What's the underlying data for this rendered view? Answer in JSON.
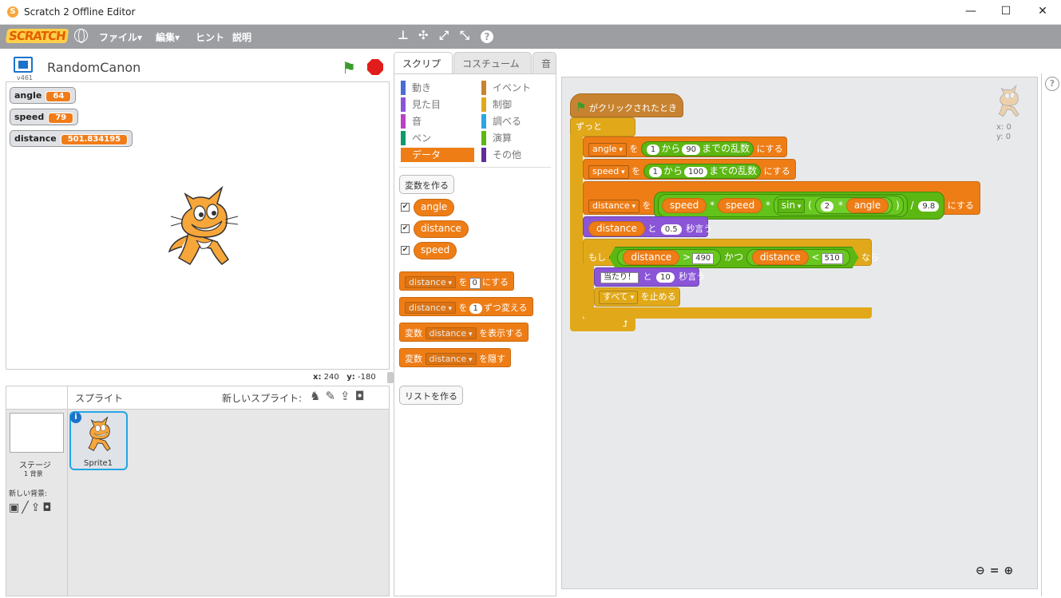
{
  "window": {
    "title": "Scratch 2 Offline Editor",
    "minimize": "—",
    "maximize": "☐",
    "close": "✕"
  },
  "menu": {
    "logo": "SCRATCH",
    "file": "ファイル▾",
    "edit": "編集▾",
    "tips": "ヒント",
    "about": "説明"
  },
  "toolbar": {
    "duplicate": "⊥",
    "delete": "✣",
    "grow": "⤢",
    "shrink": "⤡",
    "help": "?"
  },
  "stage": {
    "version": "v461",
    "project_name": "RandomCanon",
    "monitors": [
      {
        "name": "angle",
        "value": "64"
      },
      {
        "name": "speed",
        "value": "79"
      },
      {
        "name": "distance",
        "value": "501.834195"
      }
    ],
    "x_label": "x:",
    "x_value": "240",
    "y_label": "y:",
    "y_value": "-180"
  },
  "sprite_pane": {
    "sprites_label": "スプライト",
    "new_sprite_label": "新しいスプライト:",
    "stage_label": "ステージ",
    "stage_sub": "1 背景",
    "new_backdrop_label": "新しい背景:",
    "sprite_name": "Sprite1",
    "info": "i"
  },
  "tabs": [
    "スクリプト",
    "コスチューム",
    "音"
  ],
  "categories": [
    {
      "label": "動き",
      "color": "#4a6cd4"
    },
    {
      "label": "イベント",
      "color": "#c88330"
    },
    {
      "label": "見た目",
      "color": "#8a55d7"
    },
    {
      "label": "制御",
      "color": "#e1a91a"
    },
    {
      "label": "音",
      "color": "#bb42c3"
    },
    {
      "label": "調べる",
      "color": "#2ca5e2"
    },
    {
      "label": "ペン",
      "color": "#0e9a6c"
    },
    {
      "label": "演算",
      "color": "#5cb712"
    },
    {
      "label": "データ",
      "color": "#ee7d16"
    },
    {
      "label": "その他",
      "color": "#632d99"
    }
  ],
  "palette": {
    "make_var": "変数を作る",
    "vars": [
      "angle",
      "distance",
      "speed"
    ],
    "check": "✔",
    "set_block": {
      "var": "distance",
      "to": "を",
      "val": "0",
      "suffix": "にする"
    },
    "change_block": {
      "var": "distance",
      "to": "を",
      "val": "1",
      "suffix": "ずつ変える"
    },
    "show_block": {
      "prefix": "変数",
      "var": "distance",
      "suffix": "を表示する"
    },
    "hide_block": {
      "prefix": "変数",
      "var": "distance",
      "suffix": "を隠す"
    },
    "make_list": "リストを作る"
  },
  "script": {
    "hat": "がクリックされたとき",
    "forever": "ずっと",
    "set_angle": {
      "var": "angle",
      "wo": "を",
      "a": "1",
      "kara": "から",
      "b": "90",
      "rand": "までの乱数",
      "ni": "にする"
    },
    "set_speed": {
      "var": "speed",
      "wo": "を",
      "a": "1",
      "kara": "から",
      "b": "100",
      "rand": "までの乱数",
      "ni": "にする"
    },
    "set_distance": {
      "var": "distance",
      "wo": "を",
      "speed1": "speed",
      "mul1": "*",
      "speed2": "speed",
      "mul2": "*",
      "fn": "sin",
      "lp": "(",
      "two": "2",
      "mul3": "*",
      "angle": "angle",
      "rp": ")",
      "div": "/",
      "g": "9.8",
      "ni": "にする"
    },
    "say": {
      "var": "distance",
      "to": "と",
      "secs": "0.5",
      "suffix": "秒言う"
    },
    "if": {
      "moshi": "もし",
      "v1": "distance",
      "gt": ">",
      "n1": "490",
      "and": "かつ",
      "v2": "distance",
      "lt": "<",
      "n2": "510",
      "nara": "なら"
    },
    "say2": {
      "msg": "当たり！",
      "to": "と",
      "secs": "10",
      "suffix": "秒言う"
    },
    "stop": {
      "opt": "すべて",
      "suffix": "を止める"
    },
    "sprite_x": "x: 0",
    "sprite_y": "y: 0"
  }
}
